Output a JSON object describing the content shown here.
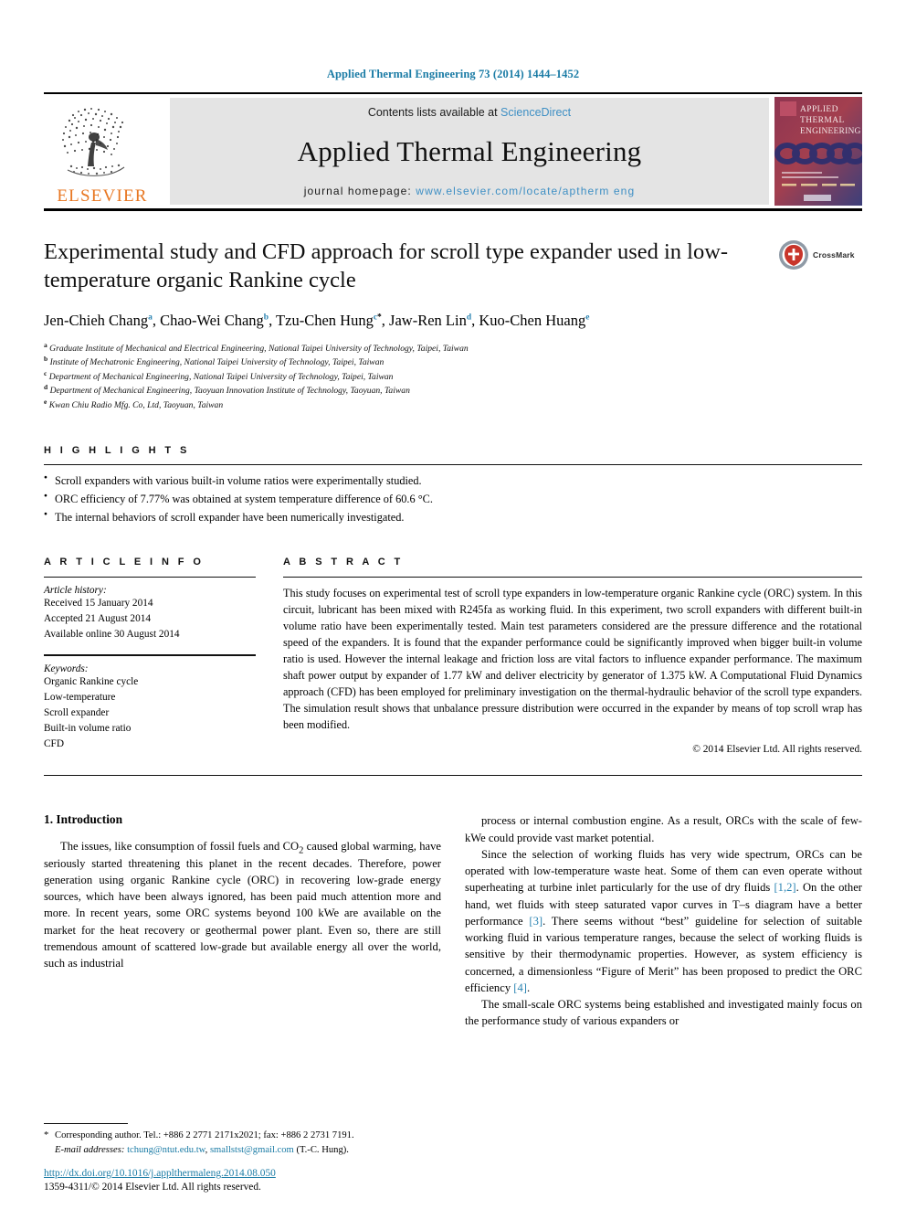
{
  "running_head": "Applied Thermal Engineering 73 (2014) 1444–1452",
  "masthead": {
    "publisher": "ELSEVIER",
    "contents_prefix": "Contents lists available at ",
    "contents_link": "ScienceDirect",
    "journal_title": "Applied Thermal Engineering",
    "homepage_prefix": "journal homepage: ",
    "homepage_url": "www.elsevier.com/locate/aptherm eng",
    "cover": {
      "line1": "APPLIED",
      "line2": "THERMAL",
      "line3": "ENGINEERING"
    }
  },
  "article": {
    "title": "Experimental study and CFD approach for scroll type expander used in low-temperature organic Rankine cycle",
    "crossmark_label": "CrossMark",
    "authors_line1": "Jen-Chieh Chang",
    "authors": [
      {
        "name": "Jen-Chieh Chang",
        "marker": "a",
        "sep": ", "
      },
      {
        "name": "Chao-Wei Chang",
        "marker": "b",
        "sep": ", "
      },
      {
        "name": "Tzu-Chen Hung",
        "marker": "c",
        "star": "*",
        "sep": ", "
      },
      {
        "name": "Jaw-Ren Lin",
        "marker": "d",
        "sep": ", "
      },
      {
        "name": "Kuo-Chen Huang",
        "marker": "e",
        "sep": ""
      }
    ],
    "affiliations": [
      {
        "marker": "a",
        "text": "Graduate Institute of Mechanical and Electrical Engineering, National Taipei University of Technology, Taipei, Taiwan"
      },
      {
        "marker": "b",
        "text": "Institute of Mechatronic Engineering, National Taipei University of Technology, Taipei, Taiwan"
      },
      {
        "marker": "c",
        "text": "Department of Mechanical Engineering, National Taipei University of Technology, Taipei, Taiwan"
      },
      {
        "marker": "d",
        "text": "Department of Mechanical Engineering, Taoyuan Innovation Institute of Technology, Taoyuan, Taiwan"
      },
      {
        "marker": "e",
        "text": "Kwan Chiu Radio Mfg. Co, Ltd, Taoyuan, Taiwan"
      }
    ]
  },
  "highlights": {
    "heading": "H I G H L I G H T S",
    "items": [
      "Scroll expanders with various built-in volume ratios were experimentally studied.",
      "ORC efficiency of 7.77% was obtained at system temperature difference of 60.6 °C.",
      "The internal behaviors of scroll expander have been numerically investigated."
    ]
  },
  "article_info": {
    "heading": "A R T I C L E   I N F O",
    "history_title": "Article history:",
    "history": [
      "Received 15 January 2014",
      "Accepted 21 August 2014",
      "Available online 30 August 2014"
    ],
    "keywords_title": "Keywords:",
    "keywords": [
      "Organic Rankine cycle",
      "Low-temperature",
      "Scroll expander",
      "Built-in volume ratio",
      "CFD"
    ]
  },
  "abstract": {
    "heading": "A B S T R A C T",
    "text": "This study focuses on experimental test of scroll type expanders in low-temperature organic Rankine cycle (ORC) system. In this circuit, lubricant has been mixed with R245fa as working fluid. In this experiment, two scroll expanders with different built-in volume ratio have been experimentally tested. Main test parameters considered are the pressure difference and the rotational speed of the expanders. It is found that the expander performance could be significantly improved when bigger built-in volume ratio is used. However the internal leakage and friction loss are vital factors to influence expander performance. The maximum shaft power output by expander of 1.77 kW and deliver electricity by generator of 1.375 kW. A Computational Fluid Dynamics approach (CFD) has been employed for preliminary investigation on the thermal-hydraulic behavior of the scroll type expanders. The simulation result shows that unbalance pressure distribution were occurred in the expander by means of top scroll wrap has been modified.",
    "copyright": "© 2014 Elsevier Ltd. All rights reserved."
  },
  "body": {
    "section_number_title": "1. Introduction",
    "col1_para1_a": "The issues, like consumption of fossil fuels and CO",
    "col1_para1_sub": "2",
    "col1_para1_b": " caused global warming, have seriously started threatening this planet in the recent decades. Therefore, power generation using organic Rankine cycle (ORC) in recovering low-grade energy sources, which have been always ignored, has been paid much attention more and more. In recent years, some ORC systems beyond 100 kWe are available on the market for the heat recovery or geothermal power plant. Even so, there are still tremendous amount of scattered low-grade but available energy all over the world, such as industrial",
    "col2_para1": "process or internal combustion engine. As a result, ORCs with the scale of few-kWe could provide vast market potential.",
    "col2_para2_a": "Since the selection of working fluids has very wide spectrum, ORCs can be operated with low-temperature waste heat. Some of them can even operate without superheating at turbine inlet particularly for the use of dry fluids ",
    "col2_ref1": "[1,2]",
    "col2_para2_b": ". On the other hand, wet fluids with steep saturated vapor curves in T–s diagram have a better performance ",
    "col2_ref2": "[3]",
    "col2_para2_c": ". There seems without “best” guideline for selection of suitable working fluid in various temperature ranges, because the select of working fluids is sensitive by their thermodynamic properties. However, as system efficiency is concerned, a dimensionless “Figure of Merit” has been proposed to predict the ORC efficiency ",
    "col2_ref3": "[4]",
    "col2_para2_d": ".",
    "col2_para3": "The small-scale ORC systems being established and investigated mainly focus on the performance study of various expanders or"
  },
  "footnotes": {
    "star": "*",
    "corresponding": "Corresponding author. Tel.: +886 2 2771 2171x2021; fax: +886 2 2731 7191.",
    "email_label": "E-mail addresses:",
    "email1": "tchung@ntut.edu.tw",
    "email_sep": ", ",
    "email2": "smallstst@gmail.com",
    "email_suffix": " (T.-C. Hung)."
  },
  "doi": {
    "url": "http://dx.doi.org/10.1016/j.applthermaleng.2014.08.050",
    "copyright": "1359-4311/© 2014 Elsevier Ltd. All rights reserved."
  },
  "colors": {
    "link_blue": "#1a7ba5",
    "sd_blue": "#3e8fc4",
    "elsevier_orange": "#E87722",
    "band_gray": "#e4e4e4"
  }
}
